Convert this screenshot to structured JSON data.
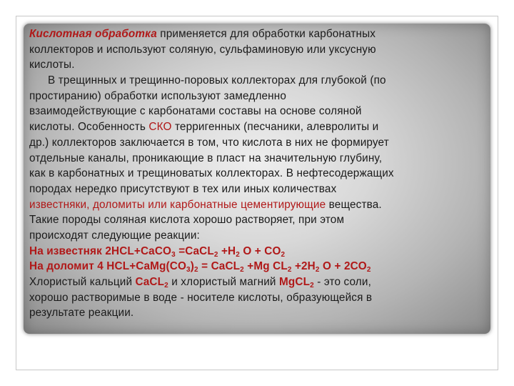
{
  "slide": {
    "l1_title": "Кислотная обработка",
    "l1_rest": " применяется для обработки карбонатных",
    "l2": "коллекторов и используют соляную, сульфаминовую или уксусную",
    "l3": "кислоты.",
    "l4": "В трещинных и трещинно-поровых коллекторах для глубокой (по",
    "l5": "простиранию) обработки используют замедленно",
    "l6": "взаимодействующие с карбонатами составы на основе соляной",
    "l7_a": "кислоты. Особенность ",
    "l7_sko": "СКО",
    "l7_b": " терригенных (песчаники, алевролиты и",
    "l8": "др.) коллекторов заключается в том, что кислота в них не формирует",
    "l9": "отдельные каналы, проникающие в пласт на значительную глубину,",
    "l10": "как в карбонатных и трещиноватых коллекторах. В нефтесодержащих",
    "l11": "породах нередко присутствуют в тех или иных количествах",
    "l12_red": "известняки, доломиты или карбонатные цементирующие",
    "l12_rest": " вещества.",
    "l13": "Такие породы соляная кислота хорошо растворяет, при этом",
    "l14": "происходят следующие реакции:",
    "r1": {
      "prefix": "На известняк 2HCL+CaCO",
      "s1": "3",
      "p2": " =CaCL",
      "s2": "2",
      "p3": " +H",
      "s3": "2",
      "p4": " O + CO",
      "s4": "2"
    },
    "r2": {
      "prefix": " На доломит 4 HCL+CaMg(CO",
      "s1": "3",
      "p2": ")",
      "s2": "2",
      "p3": " = CaCL",
      "s3": "2",
      "p4": " +Mg CL",
      "s4": "2",
      "p5": " +2H",
      "s5": "2",
      "p6": " O + 2CO",
      "s6": "2"
    },
    "l17_a": "Хлористый кальций ",
    "l17_c1": "CaCL",
    "l17_s1": "2",
    "l17_b": " и хлористый магний ",
    "l17_c2": "MgCL",
    "l17_s2": "2",
    "l17_c": "  - это соли,",
    "l18": "хорошо растворимые в воде - носителе кислоты, образующейся в",
    "l19": "результате реакции."
  }
}
